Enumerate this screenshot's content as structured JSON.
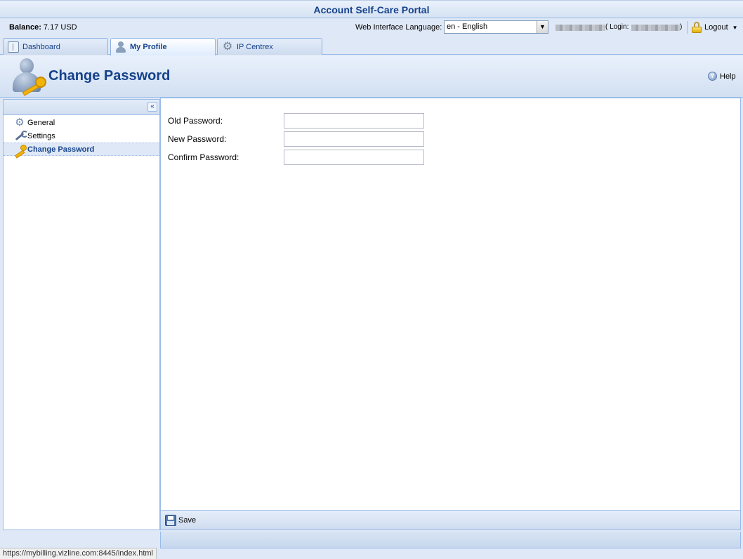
{
  "app": {
    "title": "Account Self-Care Portal"
  },
  "infobar": {
    "balance_label": "Balance:",
    "balance_value": "7.17 USD",
    "language_label": "Web Interface Language:",
    "language_selected": "en - English",
    "login_open": "( Login:",
    "login_close": ")",
    "logout_label": "Logout"
  },
  "tabs": [
    {
      "label": "Dashboard",
      "icon": "dashboard-icon"
    },
    {
      "label": "My Profile",
      "icon": "person-icon",
      "active": true
    },
    {
      "label": "IP Centrex",
      "icon": "gear-icon"
    }
  ],
  "header": {
    "title": "Change Password",
    "help_label": "Help"
  },
  "sidebar": {
    "collapse_glyph": "«",
    "items": [
      {
        "label": "General",
        "icon": "gear-icon"
      },
      {
        "label": "Settings",
        "icon": "wrench-icon"
      },
      {
        "label": "Change Password",
        "icon": "key-icon",
        "selected": true
      }
    ]
  },
  "form": {
    "old_password_label": "Old Password:",
    "new_password_label": "New Password:",
    "confirm_password_label": "Confirm Password:",
    "old_password_value": "",
    "new_password_value": "",
    "confirm_password_value": ""
  },
  "toolbar": {
    "save_label": "Save"
  },
  "status": {
    "url": "https://mybilling.vizline.com:8445/index.html"
  },
  "colors": {
    "accent": "#15428b",
    "border": "#99bbe8",
    "background": "#dfe8f6"
  }
}
